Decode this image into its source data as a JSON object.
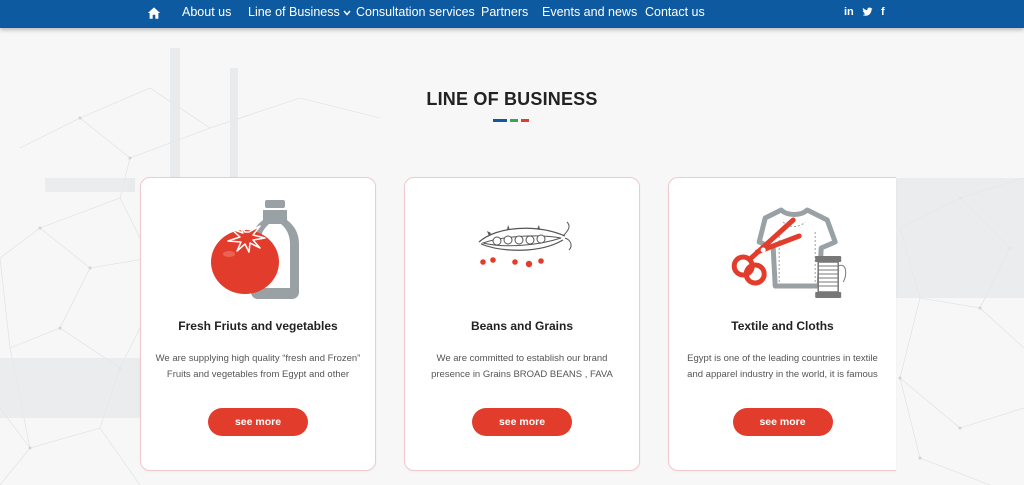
{
  "nav": {
    "home_icon": "home-icon",
    "items": [
      {
        "label": "About us"
      },
      {
        "label": "Line of Business"
      },
      {
        "label": "Consultation services"
      },
      {
        "label": "Partners"
      },
      {
        "label": "Events and news"
      },
      {
        "label": "Contact us"
      }
    ],
    "social": [
      {
        "icon": "linkedin-icon",
        "glyph": "in"
      },
      {
        "icon": "twitter-icon",
        "glyph": "❦"
      },
      {
        "icon": "facebook-icon",
        "glyph": "f"
      }
    ]
  },
  "section": {
    "title": "LINE OF BUSINESS"
  },
  "cards": [
    {
      "icon": "tomato-bottle-icon",
      "title": "Fresh Friuts and vegetables",
      "desc_line1": "We are supplying high quality “fresh and Frozen”",
      "desc_line2": "Fruits and vegetables from Egypt and other",
      "button": "see more"
    },
    {
      "icon": "pea-pod-icon",
      "title": "Beans and Grains",
      "desc_line1": "We are committed to establish our brand",
      "desc_line2": "presence in Grains  BROAD BEANS , FAVA BEANS",
      "button": "see more"
    },
    {
      "icon": "scissors-shirt-thread-icon",
      "title": "Textile and Cloths",
      "desc_line1": "Egypt is one of the leading countries in textile",
      "desc_line2": "and apparel industry in the world, it is famous",
      "button": "see more"
    }
  ],
  "colors": {
    "nav_bg": "#0d5aa0",
    "accent_red": "#e23d2c",
    "underline_blue": "#0d5aa0",
    "underline_green": "#3aa54a",
    "underline_red": "#e23d2c",
    "icon_gray": "#9aa1a5"
  }
}
